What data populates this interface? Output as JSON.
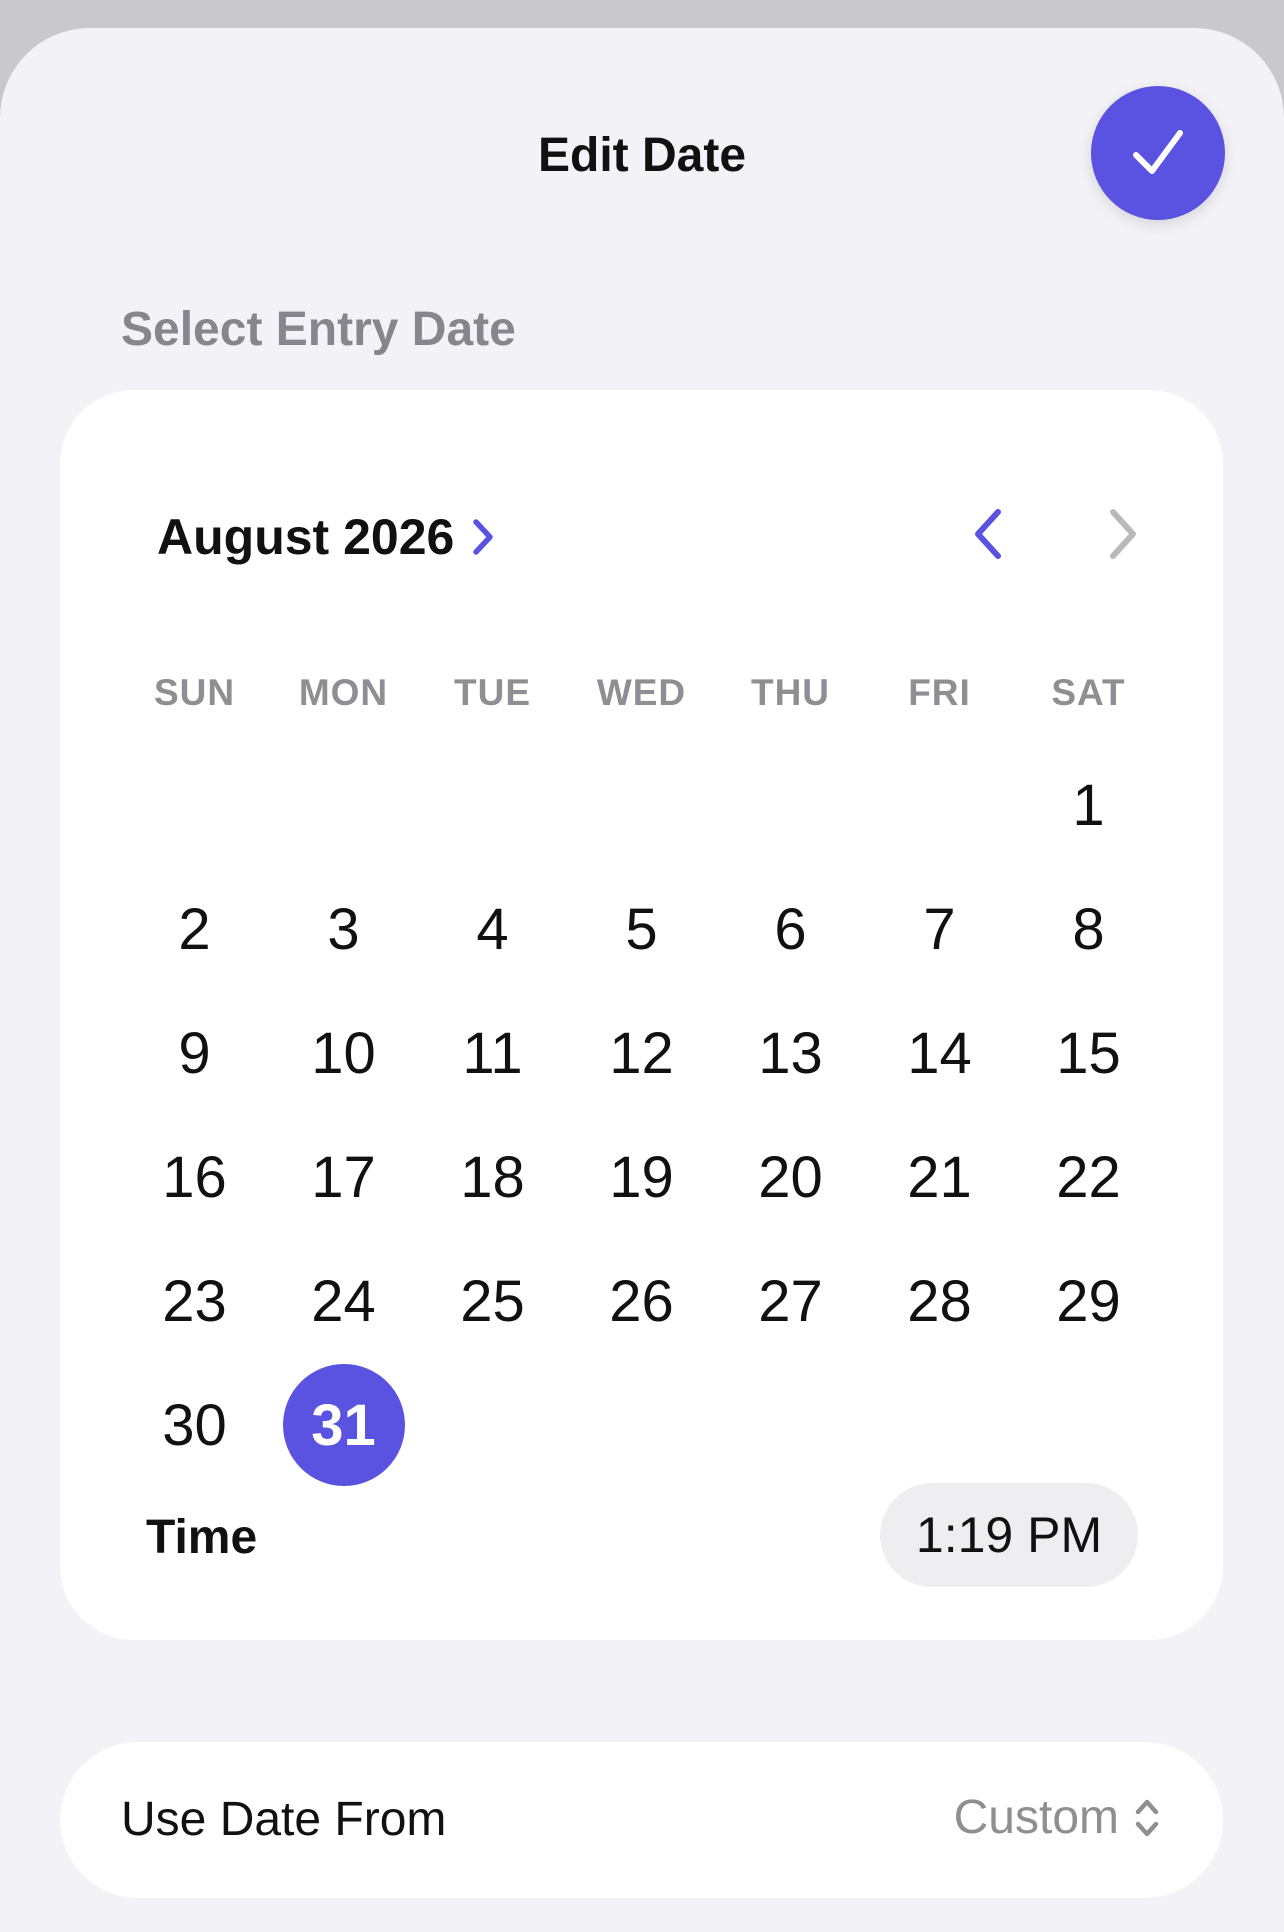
{
  "header": {
    "title": "Edit Date",
    "confirm_icon": "checkmark-icon"
  },
  "section": {
    "label": "Select Entry Date"
  },
  "calendar": {
    "month_label": "August 2026",
    "weekdays": [
      "SUN",
      "MON",
      "TUE",
      "WED",
      "THU",
      "FRI",
      "SAT"
    ],
    "first_weekday_index": 6,
    "days_in_month": 31,
    "selected_day": 31,
    "accent_color": "#5a52e0",
    "next_disabled": true
  },
  "time": {
    "label": "Time",
    "value": "1:19 PM"
  },
  "use_date_from": {
    "label": "Use Date From",
    "value": "Custom",
    "icon": "chevron-up-down-icon"
  }
}
